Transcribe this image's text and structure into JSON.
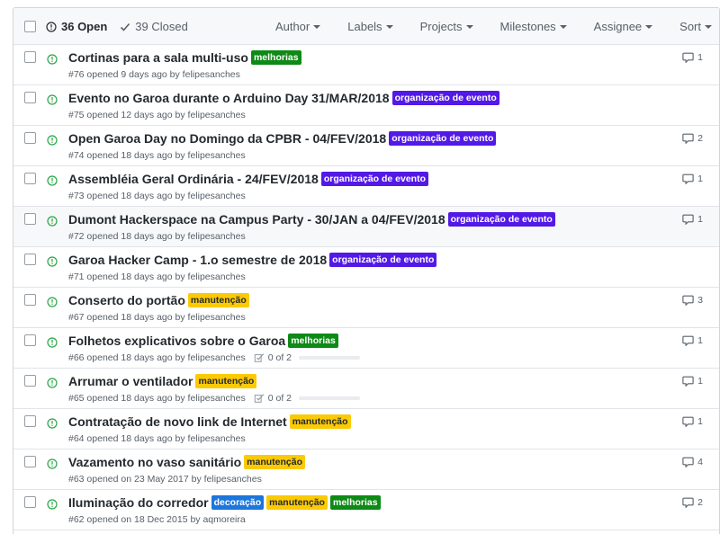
{
  "header": {
    "open_label": "36 Open",
    "closed_label": "39 Closed",
    "filters": [
      "Author",
      "Labels",
      "Projects",
      "Milestones",
      "Assignee",
      "Sort"
    ]
  },
  "colors": {
    "open_icon": "#28a745",
    "melhorias": "#0e8a16",
    "organizacao": "#5319e7",
    "manutencao": "#fbca04",
    "decoracao": "#1d76db"
  },
  "issues": [
    {
      "title": "Cortinas para a sala multi-uso",
      "labels": [
        {
          "text": "melhorias",
          "bg": "#0e8a16",
          "fg": "#ffffff"
        }
      ],
      "meta": "#76 opened 9 days ago by felipesanches",
      "comments": "1",
      "tasks": ""
    },
    {
      "title": "Evento no Garoa durante o Arduino Day 31/MAR/2018",
      "labels": [
        {
          "text": "organização de evento",
          "bg": "#5319e7",
          "fg": "#ffffff"
        }
      ],
      "meta": "#75 opened 12 days ago by felipesanches",
      "comments": "",
      "tasks": ""
    },
    {
      "title": "Open Garoa Day no Domingo da CPBR - 04/FEV/2018",
      "labels": [
        {
          "text": "organização de evento",
          "bg": "#5319e7",
          "fg": "#ffffff"
        }
      ],
      "meta": "#74 opened 18 days ago by felipesanches",
      "comments": "2",
      "tasks": ""
    },
    {
      "title": "Assembléia Geral Ordinária - 24/FEV/2018",
      "labels": [
        {
          "text": "organização de evento",
          "bg": "#5319e7",
          "fg": "#ffffff"
        }
      ],
      "meta": "#73 opened 18 days ago by felipesanches",
      "comments": "1",
      "tasks": ""
    },
    {
      "title": "Dumont Hackerspace na Campus Party - 30/JAN a 04/FEV/2018",
      "labels": [
        {
          "text": "organização de evento",
          "bg": "#5319e7",
          "fg": "#ffffff"
        }
      ],
      "meta": "#72 opened 18 days ago by felipesanches",
      "comments": "1",
      "tasks": "",
      "highlighted": true
    },
    {
      "title": "Garoa Hacker Camp - 1.o semestre de 2018",
      "labels": [
        {
          "text": "organização de evento",
          "bg": "#5319e7",
          "fg": "#ffffff"
        }
      ],
      "meta": "#71 opened 18 days ago by felipesanches",
      "comments": "",
      "tasks": ""
    },
    {
      "title": "Conserto do portão",
      "labels": [
        {
          "text": "manutenção",
          "bg": "#fbca04",
          "fg": "#24292e"
        }
      ],
      "meta": "#67 opened 18 days ago by felipesanches",
      "comments": "3",
      "tasks": ""
    },
    {
      "title": "Folhetos explicativos sobre o Garoa",
      "labels": [
        {
          "text": "melhorias",
          "bg": "#0e8a16",
          "fg": "#ffffff"
        }
      ],
      "meta": "#66 opened 18 days ago by felipesanches",
      "comments": "1",
      "tasks": "0 of 2"
    },
    {
      "title": "Arrumar o ventilador",
      "labels": [
        {
          "text": "manutenção",
          "bg": "#fbca04",
          "fg": "#24292e"
        }
      ],
      "meta": "#65 opened 18 days ago by felipesanches",
      "comments": "1",
      "tasks": "0 of 2"
    },
    {
      "title": "Contratação de novo link de Internet",
      "labels": [
        {
          "text": "manutenção",
          "bg": "#fbca04",
          "fg": "#24292e"
        }
      ],
      "meta": "#64 opened 18 days ago by felipesanches",
      "comments": "1",
      "tasks": ""
    },
    {
      "title": "Vazamento no vaso sanitário",
      "labels": [
        {
          "text": "manutenção",
          "bg": "#fbca04",
          "fg": "#24292e"
        }
      ],
      "meta": "#63 opened on 23 May 2017 by felipesanches",
      "comments": "4",
      "tasks": ""
    },
    {
      "title": "Iluminação do corredor",
      "labels": [
        {
          "text": "decoração",
          "bg": "#1d76db",
          "fg": "#ffffff"
        },
        {
          "text": "manutenção",
          "bg": "#fbca04",
          "fg": "#24292e"
        },
        {
          "text": "melhorias",
          "bg": "#0e8a16",
          "fg": "#ffffff"
        }
      ],
      "meta": "#62 opened on 18 Dec 2015 by aqmoreira",
      "comments": "2",
      "tasks": ""
    }
  ]
}
